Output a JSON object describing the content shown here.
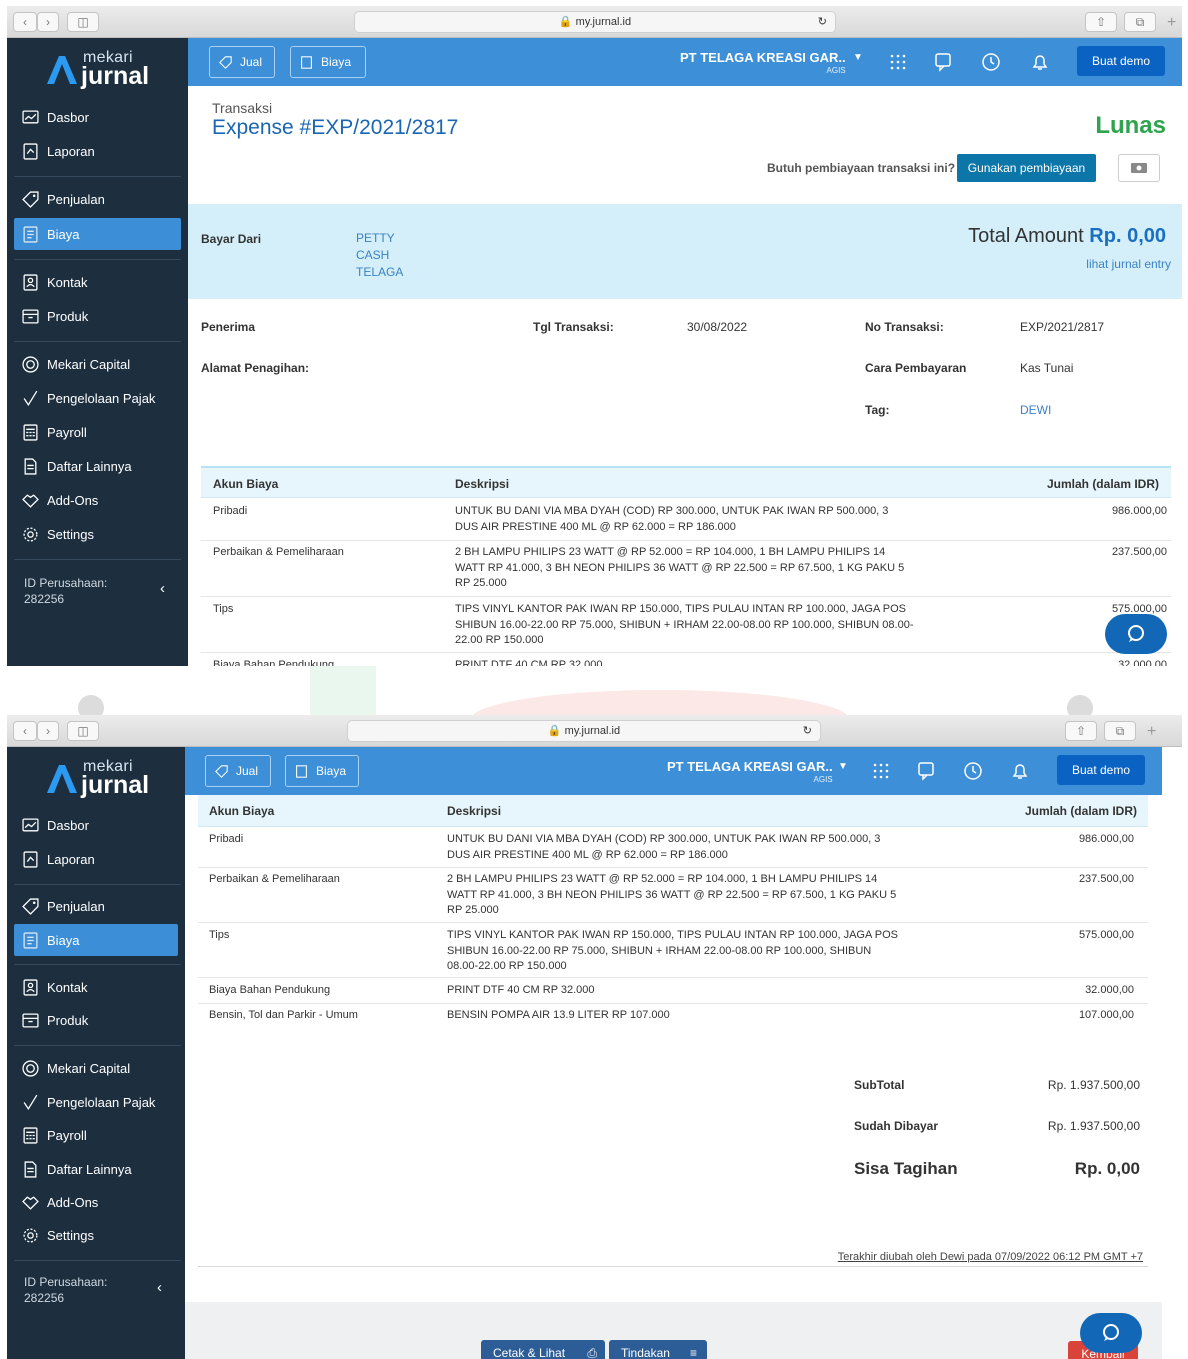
{
  "browser": {
    "url": "my.jurnal.id"
  },
  "brand": {
    "line1": "mekari",
    "line2": "jurnal"
  },
  "sidebar": {
    "items": [
      {
        "label": "Dasbor"
      },
      {
        "label": "Laporan"
      },
      {
        "label": "Penjualan"
      },
      {
        "label": "Biaya"
      },
      {
        "label": "Kontak"
      },
      {
        "label": "Produk"
      },
      {
        "label": "Mekari Capital"
      },
      {
        "label": "Pengelolaan Pajak"
      },
      {
        "label": "Payroll"
      },
      {
        "label": "Daftar Lainnya"
      },
      {
        "label": "Add-Ons"
      },
      {
        "label": "Settings"
      }
    ],
    "active": "Biaya",
    "company_id_label": "ID Perusahaan:",
    "company_id": "282256"
  },
  "topbar": {
    "jual": "Jual",
    "biaya": "Biaya",
    "company": "PT TELAGA KREASI GAR..",
    "user": "AGIS",
    "demo": "Buat demo"
  },
  "header": {
    "breadcrumb": "Transaksi",
    "title": "Expense #EXP/2021/2817",
    "status": "Lunas",
    "financing_question": "Butuh pembiayaan transaksi ini?",
    "financing_button": "Gunakan pembiayaan"
  },
  "summary": {
    "bayar_dari_label": "Bayar Dari",
    "bayar_dari_value": "PETTY CASH TELAGA",
    "total_label": "Total Amount",
    "total_value": "Rp. 0,00",
    "journal_link": "lihat jurnal entry"
  },
  "details": {
    "penerima_label": "Penerima",
    "tgl_label": "Tgl Transaksi:",
    "tgl_value": "30/08/2022",
    "no_label": "No Transaksi:",
    "no_value": "EXP/2021/2817",
    "alamat_label": "Alamat Penagihan:",
    "cara_label": "Cara Pembayaran",
    "cara_value": "Kas Tunai",
    "tag_label": "Tag:",
    "tag_value": "DEWI"
  },
  "table": {
    "headers": [
      "Akun Biaya",
      "Deskripsi",
      "Jumlah (dalam IDR)"
    ],
    "rows": [
      {
        "akun": "Pribadi",
        "desc": "UNTUK BU DANI VIA MBA DYAH (COD) RP 300.000, UNTUK PAK IWAN RP 500.000, 3 DUS AIR PRESTINE 400 ML @ RP 62.000 = RP 186.000",
        "jumlah": "986.000,00"
      },
      {
        "akun": "Perbaikan & Pemeliharaan",
        "desc": "2 BH LAMPU PHILIPS 23 WATT @ RP 52.000 = RP 104.000, 1 BH LAMPU PHILIPS 14 WATT RP 41.000, 3 BH NEON PHILIPS 36 WATT @ RP 22.500 = RP 67.500, 1 KG PAKU 5 RP 25.000",
        "jumlah": "237.500,00"
      },
      {
        "akun": "Tips",
        "desc": "TIPS VINYL KANTOR PAK IWAN RP 150.000, TIPS PULAU INTAN RP 100.000, JAGA POS SHIBUN 16.00-22.00 RP 75.000, SHIBUN + IRHAM 22.00-08.00 RP 100.000, SHIBUN 08.00-22.00 RP 150.000",
        "jumlah": "575.000,00"
      },
      {
        "akun": "Biaya Bahan Pendukung",
        "desc": "PRINT DTF 40 CM RP 32.000",
        "jumlah": "32.000,00"
      },
      {
        "akun": "Bensin, Tol dan Parkir - Umum",
        "desc": "BENSIN POMPA AIR 13.9 LITER RP 107.000",
        "jumlah": "107.000,00"
      }
    ]
  },
  "totals": {
    "subtotal_label": "SubTotal",
    "subtotal_value": "Rp. 1.937.500,00",
    "paid_label": "Sudah Dibayar",
    "paid_value": "Rp. 1.937.500,00",
    "remaining_label": "Sisa Tagihan",
    "remaining_value": "Rp. 0,00"
  },
  "footer": {
    "last_modified": "Terakhir diubah oleh Dewi pada 07/09/2022 06:12 PM GMT +7",
    "print_button": "Cetak & Lihat",
    "action_button": "Tindakan",
    "back_button": "Kembali"
  },
  "colors": {
    "sidebar": "#1d2f3f",
    "topbar": "#3d8fd8",
    "active": "#3c8fd7",
    "status": "#2ea44f",
    "link": "#3b82c4",
    "total": "#1a6fc1"
  }
}
